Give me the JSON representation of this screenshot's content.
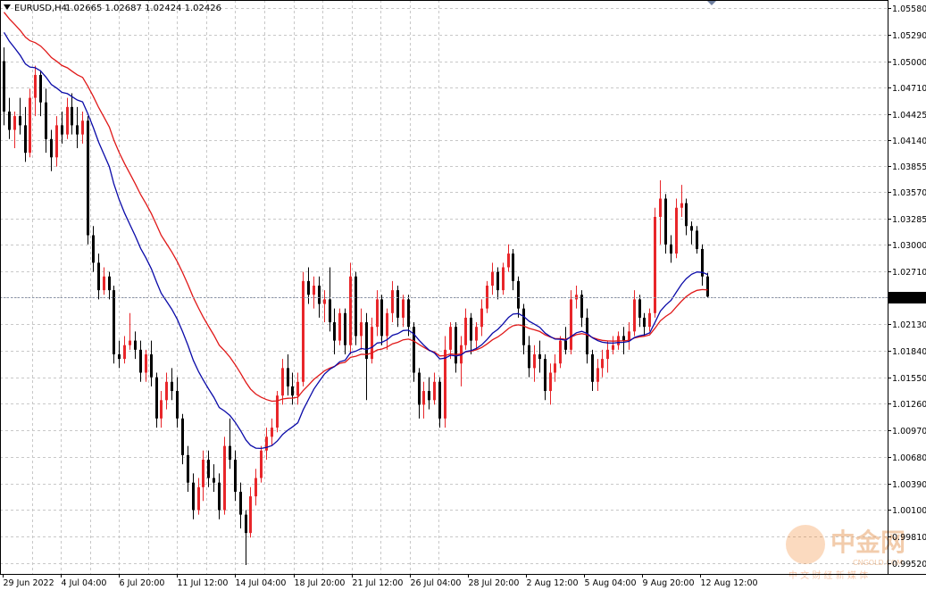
{
  "header": {
    "symbol": "EURUSD,H4",
    "quote": "1.02665 1.02687 1.02424 1.02426"
  },
  "colors": {
    "bull": "#e8262a",
    "bear": "#000000",
    "ma_fast": "#0a0aa8",
    "ma_slow": "#e01818",
    "grid": "#c8c8c8",
    "current_price_line": "#8a93a8"
  },
  "watermark": {
    "brand": "中金网",
    "sub": "CNGOLD.COM",
    "tagline": "中 文 财 经 新 媒 体"
  },
  "chart_data": {
    "type": "candlestick",
    "title": "EURUSD,H4",
    "grid": true,
    "ylim": [
      0.9952,
      1.0558
    ],
    "y_ticks": [
      "1.05580",
      "1.05290",
      "1.05000",
      "1.04710",
      "1.04425",
      "1.04140",
      "1.03855",
      "1.03570",
      "1.03285",
      "1.03000",
      "1.02710",
      "1.02425",
      "1.02130",
      "1.01840",
      "1.01550",
      "1.01260",
      "1.00970",
      "1.00680",
      "1.00390",
      "1.00100",
      "0.99810",
      "0.99520"
    ],
    "x_labels": [
      "29 Jun 2022",
      "4 Jul 04:00",
      "6 Jul 20:00",
      "11 Jul 12:00",
      "14 Jul 04:00",
      "18 Jul 20:00",
      "21 Jul 12:00",
      "26 Jul 04:00",
      "28 Jul 20:00",
      "2 Aug 12:00",
      "5 Aug 04:00",
      "9 Aug 20:00",
      "12 Aug 12:00"
    ],
    "current_price": "1.02426",
    "ma_fast_name": "",
    "ma_slow_name": "",
    "ohlc": [
      [
        1.05,
        1.0515,
        1.043,
        1.0445
      ],
      [
        1.0445,
        1.046,
        1.0415,
        1.0425
      ],
      [
        1.0425,
        1.0445,
        1.0405,
        1.044
      ],
      [
        1.044,
        1.046,
        1.042,
        1.043
      ],
      [
        1.043,
        1.045,
        1.039,
        1.04
      ],
      [
        1.04,
        1.047,
        1.0395,
        1.046
      ],
      [
        1.046,
        1.0495,
        1.044,
        1.0485
      ],
      [
        1.0485,
        1.049,
        1.044,
        1.0455
      ],
      [
        1.0455,
        1.047,
        1.04,
        1.0415
      ],
      [
        1.0415,
        1.0425,
        1.038,
        1.0395
      ],
      [
        1.0395,
        1.044,
        1.0385,
        1.043
      ],
      [
        1.043,
        1.0445,
        1.041,
        1.042
      ],
      [
        1.042,
        1.046,
        1.0415,
        1.045
      ],
      [
        1.045,
        1.0465,
        1.042,
        1.043
      ],
      [
        1.043,
        1.045,
        1.0405,
        1.042
      ],
      [
        1.042,
        1.0445,
        1.041,
        1.0435
      ],
      [
        1.0435,
        1.044,
        1.03,
        1.031
      ],
      [
        1.031,
        1.032,
        1.027,
        1.028
      ],
      [
        1.028,
        1.029,
        1.024,
        1.025
      ],
      [
        1.025,
        1.0275,
        1.0245,
        1.0265
      ],
      [
        1.0265,
        1.027,
        1.024,
        1.025
      ],
      [
        1.025,
        1.0255,
        1.017,
        1.018
      ],
      [
        1.018,
        1.0195,
        1.0165,
        1.0175
      ],
      [
        1.0175,
        1.02,
        1.017,
        1.019
      ],
      [
        1.019,
        1.0225,
        1.0185,
        1.0195
      ],
      [
        1.0195,
        1.0205,
        1.0175,
        1.0185
      ],
      [
        1.0185,
        1.0195,
        1.015,
        1.016
      ],
      [
        1.016,
        1.0185,
        1.015,
        1.018
      ],
      [
        1.018,
        1.0195,
        1.0145,
        1.0155
      ],
      [
        1.0155,
        1.016,
        1.01,
        1.011
      ],
      [
        1.011,
        1.014,
        1.01,
        1.013
      ],
      [
        1.013,
        1.016,
        1.012,
        1.015
      ],
      [
        1.015,
        1.0165,
        1.013,
        1.014
      ],
      [
        1.014,
        1.0155,
        1.01,
        1.011
      ],
      [
        1.011,
        1.0115,
        1.006,
        1.007
      ],
      [
        1.007,
        1.008,
        1.003,
        1.004
      ],
      [
        1.004,
        1.005,
        1.0,
        1.001
      ],
      [
        1.001,
        1.0045,
        1.0005,
        1.0035
      ],
      [
        1.0035,
        1.0075,
        1.002,
        1.0065
      ],
      [
        1.0065,
        1.0075,
        1.0035,
        1.0045
      ],
      [
        1.0045,
        1.006,
        1.003,
        1.004
      ],
      [
        1.004,
        1.005,
        1.0,
        1.001
      ],
      [
        1.001,
        1.009,
        1.0005,
        1.008
      ],
      [
        1.008,
        1.011,
        1.0055,
        1.0065
      ],
      [
        1.0065,
        1.0075,
        1.002,
        1.003
      ],
      [
        1.003,
        1.004,
        0.999,
        1.0005
      ],
      [
        1.0005,
        1.001,
        0.995,
        0.9985
      ],
      [
        0.9985,
        1.0035,
        0.998,
        1.0025
      ],
      [
        1.0025,
        1.0055,
        1.0015,
        1.0045
      ],
      [
        1.0045,
        1.008,
        1.004,
        1.0075
      ],
      [
        1.0075,
        1.01,
        1.0065,
        1.009
      ],
      [
        1.009,
        1.011,
        1.008,
        1.01
      ],
      [
        1.01,
        1.014,
        1.0095,
        1.0135
      ],
      [
        1.0135,
        1.0175,
        1.0125,
        1.0165
      ],
      [
        1.0165,
        1.018,
        1.0135,
        1.0145
      ],
      [
        1.0145,
        1.016,
        1.0125,
        1.0135
      ],
      [
        1.0135,
        1.016,
        1.0125,
        1.015
      ],
      [
        1.015,
        1.027,
        1.0145,
        1.026
      ],
      [
        1.026,
        1.0275,
        1.0235,
        1.0245
      ],
      [
        1.0245,
        1.0265,
        1.023,
        1.0255
      ],
      [
        1.0255,
        1.0265,
        1.022,
        1.0235
      ],
      [
        1.0235,
        1.025,
        1.0215,
        1.024
      ],
      [
        1.024,
        1.0275,
        1.0205,
        1.0215
      ],
      [
        1.0215,
        1.023,
        1.018,
        1.0195
      ],
      [
        1.0195,
        1.023,
        1.019,
        1.0225
      ],
      [
        1.0225,
        1.023,
        1.018,
        1.019
      ],
      [
        1.019,
        1.028,
        1.018,
        1.0265
      ],
      [
        1.0265,
        1.027,
        1.019,
        1.02
      ],
      [
        1.02,
        1.023,
        1.0185,
        1.0215
      ],
      [
        1.0215,
        1.0225,
        1.013,
        1.0175
      ],
      [
        1.0175,
        1.022,
        1.017,
        1.021
      ],
      [
        1.021,
        1.025,
        1.02,
        1.024
      ],
      [
        1.024,
        1.0245,
        1.019,
        1.02
      ],
      [
        1.02,
        1.023,
        1.0185,
        1.0225
      ],
      [
        1.0225,
        1.026,
        1.0215,
        1.025
      ],
      [
        1.025,
        1.0255,
        1.021,
        1.022
      ],
      [
        1.022,
        1.0245,
        1.021,
        1.024
      ],
      [
        1.024,
        1.0245,
        1.02,
        1.021
      ],
      [
        1.021,
        1.0215,
        1.015,
        1.016
      ],
      [
        1.016,
        1.0165,
        1.011,
        1.0125
      ],
      [
        1.0125,
        1.015,
        1.011,
        1.014
      ],
      [
        1.014,
        1.0155,
        1.012,
        1.013
      ],
      [
        1.013,
        1.016,
        1.0125,
        1.015
      ],
      [
        1.015,
        1.0155,
        1.01,
        1.011
      ],
      [
        1.011,
        1.02,
        1.01,
        1.0185
      ],
      [
        1.0185,
        1.0215,
        1.0175,
        1.021
      ],
      [
        1.021,
        1.0215,
        1.016,
        1.017
      ],
      [
        1.017,
        1.02,
        1.0145,
        1.019
      ],
      [
        1.019,
        1.023,
        1.0185,
        1.022
      ],
      [
        1.022,
        1.0225,
        1.018,
        1.0195
      ],
      [
        1.0195,
        1.0215,
        1.0185,
        1.021
      ],
      [
        1.021,
        1.024,
        1.02,
        1.023
      ],
      [
        1.023,
        1.026,
        1.0225,
        1.0255
      ],
      [
        1.0255,
        1.028,
        1.0245,
        1.027
      ],
      [
        1.027,
        1.0275,
        1.024,
        1.025
      ],
      [
        1.025,
        1.028,
        1.0245,
        1.0275
      ],
      [
        1.0275,
        1.03,
        1.027,
        1.029
      ],
      [
        1.029,
        1.0295,
        1.025,
        1.026
      ],
      [
        1.026,
        1.0265,
        1.022,
        1.023
      ],
      [
        1.023,
        1.0235,
        1.018,
        1.019
      ],
      [
        1.019,
        1.02,
        1.0155,
        1.0165
      ],
      [
        1.0165,
        1.019,
        1.015,
        1.018
      ],
      [
        1.018,
        1.0195,
        1.016,
        1.0175
      ],
      [
        1.0175,
        1.018,
        1.013,
        1.014
      ],
      [
        1.014,
        1.017,
        1.0125,
        1.016
      ],
      [
        1.016,
        1.018,
        1.015,
        1.017
      ],
      [
        1.017,
        1.02,
        1.0165,
        1.0195
      ],
      [
        1.0195,
        1.021,
        1.018,
        1.0185
      ],
      [
        1.0185,
        1.025,
        1.018,
        1.024
      ],
      [
        1.024,
        1.0255,
        1.023,
        1.0245
      ],
      [
        1.0245,
        1.025,
        1.021,
        1.022
      ],
      [
        1.022,
        1.023,
        1.017,
        1.018
      ],
      [
        1.018,
        1.0185,
        1.014,
        1.015
      ],
      [
        1.015,
        1.0175,
        1.014,
        1.0165
      ],
      [
        1.0165,
        1.0185,
        1.0155,
        1.0175
      ],
      [
        1.0175,
        1.0195,
        1.016,
        1.0185
      ],
      [
        1.0185,
        1.02,
        1.018,
        1.019
      ],
      [
        1.019,
        1.0205,
        1.0185,
        1.02
      ],
      [
        1.02,
        1.021,
        1.018,
        1.0195
      ],
      [
        1.0195,
        1.0215,
        1.0185,
        1.0205
      ],
      [
        1.0205,
        1.025,
        1.02,
        1.024
      ],
      [
        1.024,
        1.0245,
        1.021,
        1.022
      ],
      [
        1.022,
        1.0225,
        1.02,
        1.021
      ],
      [
        1.021,
        1.023,
        1.0205,
        1.0225
      ],
      [
        1.0225,
        1.034,
        1.022,
        1.033
      ],
      [
        1.033,
        1.037,
        1.03,
        1.035
      ],
      [
        1.035,
        1.0355,
        1.029,
        1.03
      ],
      [
        1.03,
        1.031,
        1.028,
        1.029
      ],
      [
        1.029,
        1.035,
        1.0285,
        1.034
      ],
      [
        1.034,
        1.0365,
        1.033,
        1.0345
      ],
      [
        1.0345,
        1.035,
        1.031,
        1.032
      ],
      [
        1.032,
        1.0325,
        1.03,
        1.0315
      ],
      [
        1.0315,
        1.032,
        1.029,
        1.0295
      ],
      [
        1.0295,
        1.03,
        1.0255,
        1.0265
      ],
      [
        1.0265,
        1.0269,
        1.0242,
        1.0243
      ]
    ]
  }
}
